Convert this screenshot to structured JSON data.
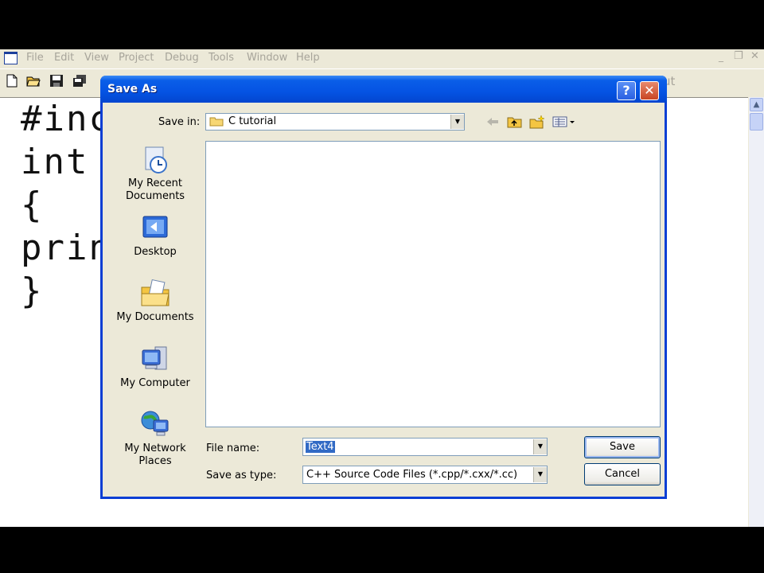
{
  "ide": {
    "menu": [
      "File",
      "Edit",
      "View",
      "Project",
      "Debug",
      "Tools",
      "Window",
      "Help"
    ],
    "toolbar_right_text": "ut",
    "code_lines": [
      "#inc",
      "int",
      "{",
      "prin",
      "}"
    ]
  },
  "dialog": {
    "title": "Save As",
    "help_glyph": "?",
    "close_glyph": "✕",
    "save_in_label": "Save in:",
    "save_in_value": "C tutorial",
    "places": [
      {
        "label": "My Recent Documents",
        "icon": "recent-documents-icon"
      },
      {
        "label": "Desktop",
        "icon": "desktop-icon"
      },
      {
        "label": "My Documents",
        "icon": "my-documents-icon"
      },
      {
        "label": "My Computer",
        "icon": "my-computer-icon"
      },
      {
        "label": "My Network Places",
        "icon": "network-places-icon"
      }
    ],
    "file_name_label": "File name:",
    "file_name_value": "Text4",
    "save_as_type_label": "Save as type:",
    "save_as_type_value": "C++ Source Code Files (*.cpp/*.cxx/*.cc)",
    "save_button": "Save",
    "cancel_button": "Cancel"
  },
  "colors": {
    "titlebar": "#0553e3",
    "dialog_bg": "#ece9d8",
    "selection": "#316ac5"
  }
}
